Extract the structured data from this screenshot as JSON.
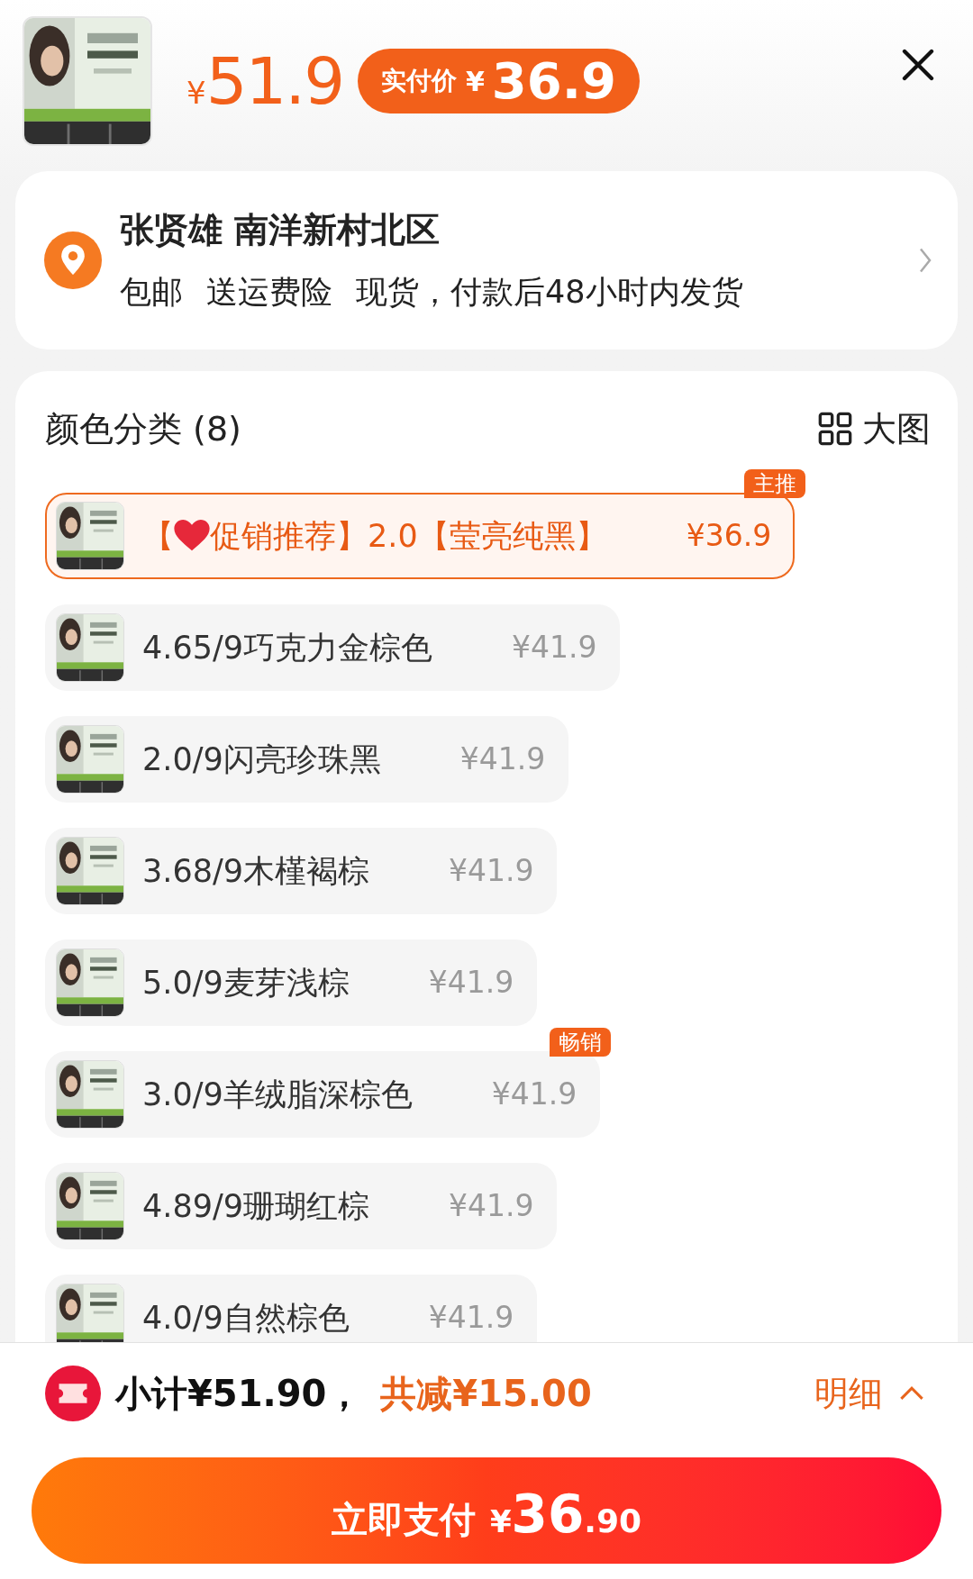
{
  "header": {
    "original_currency": "¥",
    "original_price": "51.9",
    "badge_label": "实付价",
    "badge_currency": "¥",
    "badge_price": "36.9"
  },
  "address": {
    "name_line": "张贤雄 南洋新村北区",
    "services": [
      "包邮",
      "送运费险",
      "现货，付款后48小时内发货"
    ]
  },
  "options_section": {
    "title": "颜色分类 (8)",
    "view_toggle": "大图"
  },
  "options": [
    {
      "prefix": "【",
      "heart": true,
      "label": "促销推荐】2.0【莹亮纯黑】",
      "price": "¥36.9",
      "selected": true,
      "tag": "主推"
    },
    {
      "heart": false,
      "label": "4.65/9巧克力金棕色",
      "price": "¥41.9",
      "selected": false
    },
    {
      "heart": false,
      "label": "2.0/9闪亮珍珠黑",
      "price": "¥41.9",
      "selected": false
    },
    {
      "heart": false,
      "label": "3.68/9木槿褐棕",
      "price": "¥41.9",
      "selected": false
    },
    {
      "heart": false,
      "label": "5.0/9麦芽浅棕",
      "price": "¥41.9",
      "selected": false
    },
    {
      "heart": false,
      "label": "3.0/9羊绒脂深棕色",
      "price": "¥41.9",
      "selected": false,
      "tag": "畅销"
    },
    {
      "heart": false,
      "label": "4.89/9珊瑚红棕",
      "price": "¥41.9",
      "selected": false
    },
    {
      "heart": false,
      "label": "4.0/9自然棕色",
      "price": "¥41.9",
      "selected": false
    }
  ],
  "summary": {
    "subtotal": "小计¥51.90，",
    "discount": "共减¥15.00",
    "details": "明细"
  },
  "pay_button": {
    "label": "立即支付",
    "currency": "¥",
    "amount_int": "36",
    "amount_dec": ".90"
  }
}
